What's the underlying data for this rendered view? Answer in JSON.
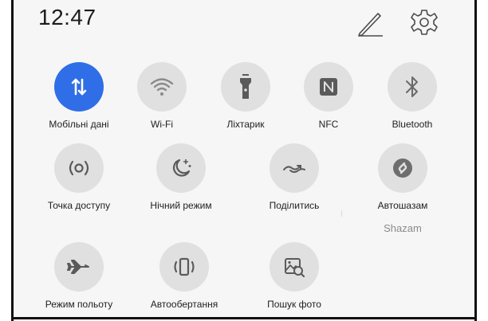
{
  "status": {
    "time": "12:47"
  },
  "header_icons": [
    {
      "name": "edit-pencil-icon"
    },
    {
      "name": "settings-gear-icon"
    }
  ],
  "tiles": {
    "mobile_data": {
      "label": "Мобільні дані",
      "icon": "mobile-data-icon",
      "active": true
    },
    "wifi": {
      "label": "Wi-Fi",
      "icon": "wifi-icon",
      "active": false
    },
    "flashlight": {
      "label": "Ліхтарик",
      "icon": "flashlight-icon",
      "active": false
    },
    "nfc": {
      "label": "NFC",
      "icon": "nfc-icon",
      "active": false
    },
    "bluetooth": {
      "label": "Bluetooth",
      "icon": "bluetooth-icon",
      "active": false
    },
    "hotspot": {
      "label": "Точка доступу",
      "icon": "hotspot-icon",
      "active": false
    },
    "night_mode": {
      "label": "Нічний режим",
      "icon": "night-mode-icon",
      "active": false
    },
    "share": {
      "label": "Поділитись",
      "icon": "share-icon",
      "active": false
    },
    "autoshazam": {
      "label": "Автошазам",
      "sublabel": "Shazam",
      "icon": "shazam-icon",
      "active": false
    },
    "airplane": {
      "label": "Режим польоту",
      "icon": "airplane-icon",
      "active": false
    },
    "autorotate": {
      "label": "Автообертання",
      "icon": "auto-rotate-icon",
      "active": false
    },
    "photo_search": {
      "label": "Пошук фото",
      "icon": "photo-search-icon",
      "active": false
    }
  },
  "colors": {
    "active": "#2f6ee6",
    "inactive": "#e0e0e0",
    "icon": "#5a5a5a"
  }
}
